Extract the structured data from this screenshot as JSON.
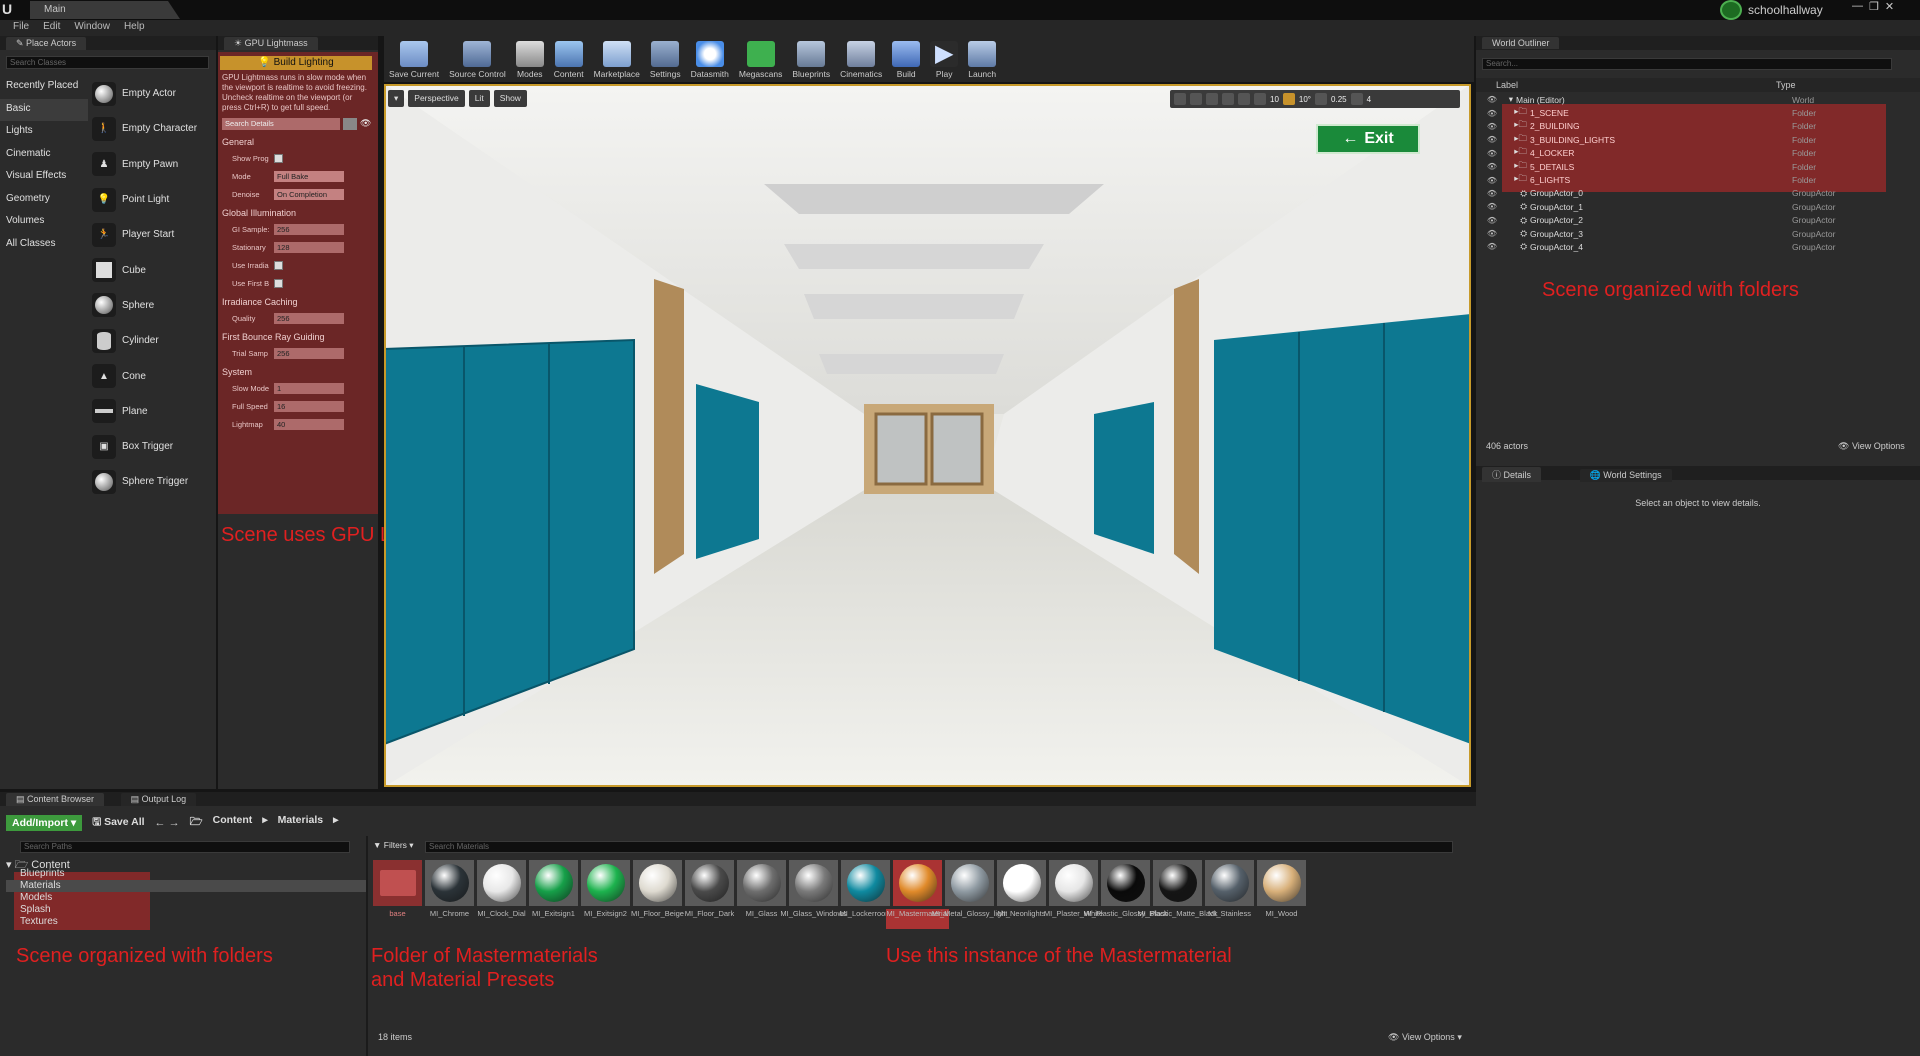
{
  "app": {
    "tab_title": "Main",
    "project_name": "schoolhallway",
    "menu": [
      "File",
      "Edit",
      "Window",
      "Help"
    ]
  },
  "place_actors": {
    "tab_label": "Place Actors",
    "search_placeholder": "Search Classes",
    "categories": [
      "Recently Placed",
      "Basic",
      "Lights",
      "Cinematic",
      "Visual Effects",
      "Geometry",
      "Volumes",
      "All Classes"
    ],
    "selected_category": "Basic",
    "items": [
      "Empty Actor",
      "Empty Character",
      "Empty Pawn",
      "Point Light",
      "Player Start",
      "Cube",
      "Sphere",
      "Cylinder",
      "Cone",
      "Plane",
      "Box Trigger",
      "Sphere Trigger"
    ]
  },
  "gpu_lightmass": {
    "tab_label": "GPU Lightmass",
    "build_button": "Build Lighting",
    "description": "GPU Lightmass runs in slow mode when the viewport is realtime to avoid freezing. Uncheck realtime on the viewport (or press Ctrl+R) to get full speed.",
    "search_placeholder": "Search Details",
    "sections": [
      {
        "title": "General",
        "rows": [
          {
            "label": "Show Prog",
            "type": "check",
            "value": ""
          },
          {
            "label": "Mode",
            "type": "select",
            "value": "Full Bake"
          },
          {
            "label": "Denoise",
            "type": "select",
            "value": "On Completion"
          }
        ]
      },
      {
        "title": "Global Illumination",
        "rows": [
          {
            "label": "GI Sample:",
            "type": "num",
            "value": "256"
          },
          {
            "label": "Stationary",
            "type": "num",
            "value": "128"
          },
          {
            "label": "Use Irradia",
            "type": "check",
            "value": ""
          },
          {
            "label": "Use First B",
            "type": "check",
            "value": ""
          }
        ]
      },
      {
        "title": "Irradiance Caching",
        "rows": [
          {
            "label": "Quality",
            "type": "num",
            "value": "256"
          }
        ]
      },
      {
        "title": "First Bounce Ray Guiding",
        "rows": [
          {
            "label": "Trial Samp",
            "type": "num",
            "value": "256"
          }
        ]
      },
      {
        "title": "System",
        "rows": [
          {
            "label": "Slow Mode",
            "type": "num",
            "value": "1"
          },
          {
            "label": "Full Speed",
            "type": "num",
            "value": "16"
          },
          {
            "label": "Lightmap",
            "type": "num",
            "value": "40"
          }
        ]
      }
    ],
    "annotation": "Scene uses GPU Lightmass"
  },
  "toolbar": {
    "buttons": [
      "Save Current",
      "Source Control",
      "Modes",
      "Content",
      "Marketplace",
      "Settings",
      "Datasmith",
      "Megascans",
      "Blueprints",
      "Cinematics",
      "Build",
      "Play",
      "Launch"
    ]
  },
  "viewport": {
    "perspective_label": "Perspective",
    "lit_label": "Lit",
    "show_label": "Show",
    "grid_snap": "10",
    "rot_snap": "10°",
    "scale_snap": "0.25",
    "camera_speed": "4",
    "exit_sign_text": "Exit"
  },
  "outliner": {
    "tab_label": "World Outliner",
    "search_placeholder": "Search...",
    "col_label": "Label",
    "col_type": "Type",
    "rows": [
      {
        "name": "Main (Editor)",
        "type": "World",
        "kind": "world"
      },
      {
        "name": "1_SCENE",
        "type": "Folder",
        "kind": "folder"
      },
      {
        "name": "2_BUILDING",
        "type": "Folder",
        "kind": "folder"
      },
      {
        "name": "3_BUILDING_LIGHTS",
        "type": "Folder",
        "kind": "folder"
      },
      {
        "name": "4_LOCKER",
        "type": "Folder",
        "kind": "folder"
      },
      {
        "name": "5_DETAILS",
        "type": "Folder",
        "kind": "folder"
      },
      {
        "name": "6_LIGHTS",
        "type": "Folder",
        "kind": "folder"
      },
      {
        "name": "GroupActor_0",
        "type": "GroupActor",
        "kind": "actor"
      },
      {
        "name": "GroupActor_1",
        "type": "GroupActor",
        "kind": "actor"
      },
      {
        "name": "GroupActor_2",
        "type": "GroupActor",
        "kind": "actor"
      },
      {
        "name": "GroupActor_3",
        "type": "GroupActor",
        "kind": "actor"
      },
      {
        "name": "GroupActor_4",
        "type": "GroupActor",
        "kind": "actor"
      }
    ],
    "annotation": "Scene organized with folders",
    "actor_count": "406 actors",
    "view_options": "View Options"
  },
  "details": {
    "tab_details": "Details",
    "tab_world_settings": "World Settings",
    "empty_message": "Select an object to view details."
  },
  "content_browser": {
    "tab_label": "Content Browser",
    "tab_output": "Output Log",
    "add_import": "Add/Import",
    "save_all": "Save All",
    "path": [
      "Content",
      "Materials"
    ],
    "search_paths_placeholder": "Search Paths",
    "filters_label": "Filters",
    "search_materials_placeholder": "Search Materials",
    "tree_root": "Content",
    "tree_items": [
      "Blueprints",
      "Materials",
      "Models",
      "Splash",
      "Textures"
    ],
    "assets": [
      {
        "name": "base",
        "color": "#c05050",
        "kind": "folder"
      },
      {
        "name": "MI_Chrome",
        "color": "#2b3338"
      },
      {
        "name": "MI_Clock_Dial",
        "color": "#e8e8e8"
      },
      {
        "name": "MI_Exitsign1",
        "color": "#16a049"
      },
      {
        "name": "MI_Exitsign2",
        "color": "#1db34e"
      },
      {
        "name": "MI_Floor_Beige",
        "color": "#dedad0"
      },
      {
        "name": "MI_Floor_Dark",
        "color": "#4a4a4a"
      },
      {
        "name": "MI_Glass",
        "color": "#6e6e6e"
      },
      {
        "name": "MI_Glass_Windows",
        "color": "#7a7a7a"
      },
      {
        "name": "MI_Lockerroom",
        "color": "#0f8aa0"
      },
      {
        "name": "MI_Mastermaterial",
        "color": "#e08a2a"
      },
      {
        "name": "MI_Metal_Glossy_light",
        "color": "#8f9aa2"
      },
      {
        "name": "MI_Neonlights",
        "color": "#ffffff"
      },
      {
        "name": "MI_Plaster_White",
        "color": "#e6e6e6"
      },
      {
        "name": "MI_Plastic_Glossy_Black",
        "color": "#0a0a0a"
      },
      {
        "name": "MI_Plastic_Matte_Black",
        "color": "#151515"
      },
      {
        "name": "MI_Stainless",
        "color": "#55606a"
      },
      {
        "name": "MI_Wood",
        "color": "#d8b07a"
      }
    ],
    "annotation_left": "Scene organized with folders",
    "annotation_middle_1": "Folder of Mastermaterials",
    "annotation_middle_2": "and Material Presets",
    "annotation_right": "Use this instance of the Mastermaterial",
    "item_count": "18 items",
    "view_options": "View Options"
  },
  "colors": {
    "accent": "#c79a2a",
    "highlight": "#c82828",
    "locker": "#0d7891"
  }
}
